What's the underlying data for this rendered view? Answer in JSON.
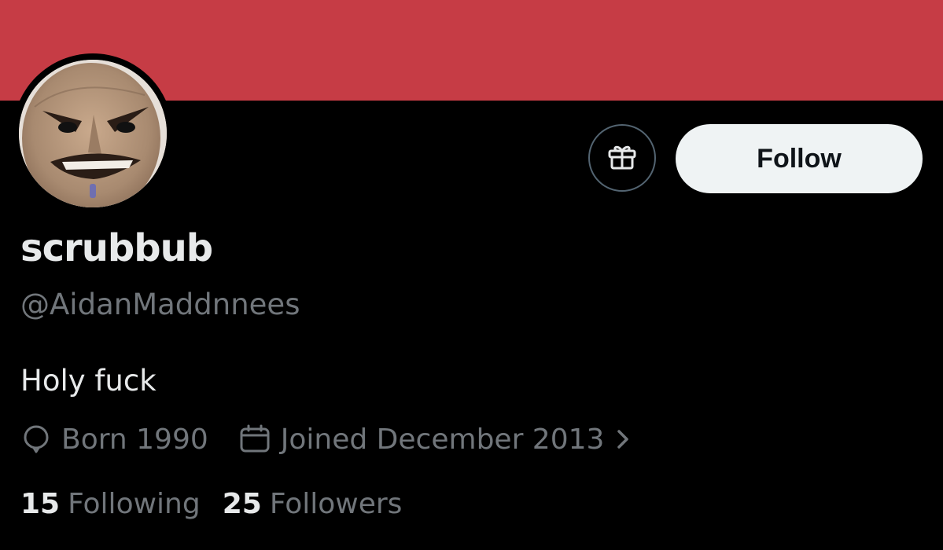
{
  "profile": {
    "banner_color": "#c63c45",
    "avatar_icon": "avatar-image",
    "display_name": "scrubbub",
    "handle": "@AidanMaddnnees",
    "bio": "Holy fuck",
    "birthday": "Born 1990",
    "joined": "Joined December 2013",
    "following_count": "15",
    "following_label": "Following",
    "followers_count": "25",
    "followers_label": "Followers"
  },
  "actions": {
    "gift_icon": "gift-icon",
    "follow_label": "Follow"
  },
  "icons": {
    "birthday": "balloon-icon",
    "joined": "calendar-icon",
    "joined_more": "chevron-right-icon"
  },
  "colors": {
    "background": "#000000",
    "primary_text": "#e7e9ea",
    "secondary_text": "#71767b",
    "follow_button_bg": "#eff3f4"
  }
}
